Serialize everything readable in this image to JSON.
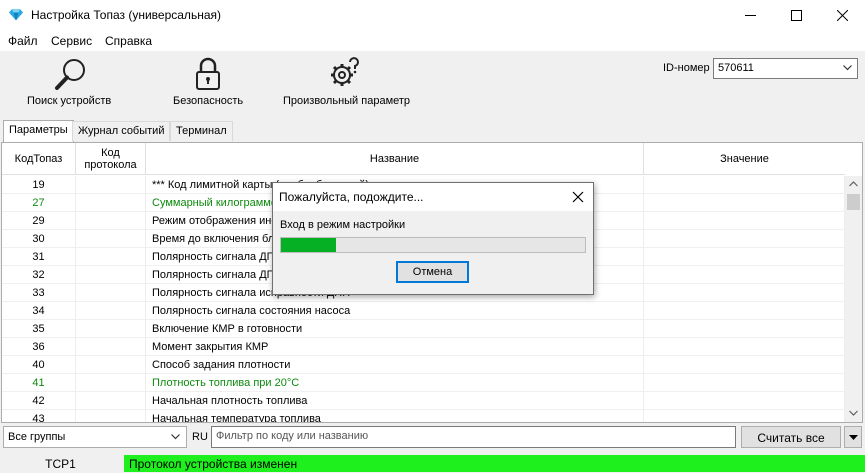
{
  "window": {
    "title": "Настройка Топаз (универсальная)"
  },
  "menu": [
    "Файл",
    "Сервис",
    "Справка"
  ],
  "toolbar": {
    "search_label": "Поиск устройств",
    "security_label": "Безопасность",
    "param_label": "Произвольный параметр",
    "id_label": "ID-номер",
    "id_value": "570611"
  },
  "tabs": [
    "Параметры",
    "Журнал событий",
    "Терминал"
  ],
  "table": {
    "headers": {
      "kod": "КодТопаз",
      "prot": "Код протокола",
      "name": "Название",
      "value": "Значение"
    },
    "rows": [
      {
        "kod": "19",
        "name": "*** Код лимитной карты (необработанный)",
        "green": false
      },
      {
        "kod": "27",
        "name": "Суммарный килограммометр",
        "green": true
      },
      {
        "kod": "29",
        "name": "Режим отображения информации",
        "green": false
      },
      {
        "kod": "30",
        "name": "Время до включения блокировки",
        "green": false
      },
      {
        "kod": "31",
        "name": "Полярность сигнала ДП",
        "green": false
      },
      {
        "kod": "32",
        "name": "Полярность сигнала ДП",
        "green": false
      },
      {
        "kod": "33",
        "name": "Полярность сигнала исправности ДПП",
        "green": false
      },
      {
        "kod": "34",
        "name": "Полярность сигнала состояния насоса",
        "green": false
      },
      {
        "kod": "35",
        "name": "Включение КМР в готовности",
        "green": false
      },
      {
        "kod": "36",
        "name": "Момент закрытия КМР",
        "green": false
      },
      {
        "kod": "40",
        "name": "Способ задания плотности",
        "green": false
      },
      {
        "kod": "41",
        "name": "Плотность топлива при 20°С",
        "green": true
      },
      {
        "kod": "42",
        "name": "Начальная плотность топлива",
        "green": false
      },
      {
        "kod": "43",
        "name": "Начальная температура топлива",
        "green": false
      }
    ]
  },
  "filter": {
    "group_value": "Все группы",
    "lang": "RU",
    "placeholder": "Фильтр по коду или названию",
    "scan_label": "Считать все"
  },
  "status": {
    "connection": "TCP1",
    "message": "Протокол устройства изменен",
    "message_color": "#1df01d"
  },
  "dialog": {
    "title": "Пожалуйста, подождите...",
    "message": "Вход в режим настройки",
    "progress": 0.18,
    "cancel_label": "Отмена"
  },
  "colors": {
    "accent": "#0078d7",
    "progress": "#06b025",
    "green_text": "#0e8a0e"
  }
}
